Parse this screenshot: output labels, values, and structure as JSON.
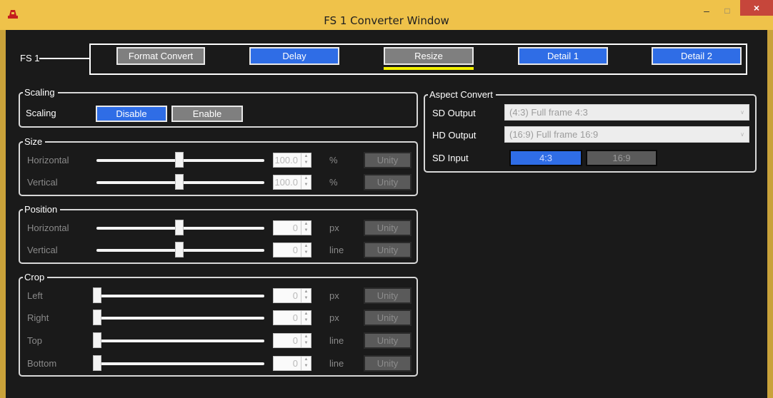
{
  "window": {
    "title": "FS 1 Converter Window",
    "minimize": "–",
    "maximize": "□",
    "close": "×"
  },
  "colors": {
    "accent_blue": "#2f6de6",
    "inactive_gray": "#7f7f7f",
    "title_bar": "#efc24a",
    "close_red": "#c6463b",
    "selected_underline": "#f3f000"
  },
  "fs": {
    "label": "FS 1",
    "tabs": [
      "Format Convert",
      "Delay",
      "Resize",
      "Detail 1",
      "Detail 2"
    ],
    "selected_tab": "Resize"
  },
  "scaling": {
    "title": "Scaling",
    "label": "Scaling",
    "disable": "Disable",
    "enable": "Enable",
    "selected": "Disable"
  },
  "size": {
    "title": "Size",
    "horizontal": {
      "label": "Horizontal",
      "value": "100.0",
      "unit": "%",
      "slider_level": 0.5
    },
    "vertical": {
      "label": "Vertical",
      "value": "100.0",
      "unit": "%",
      "slider_level": 0.5
    },
    "unity": "Unity"
  },
  "position": {
    "title": "Position",
    "horizontal": {
      "label": "Horizontal",
      "value": "0",
      "unit": "px",
      "slider_level": 0.5
    },
    "vertical": {
      "label": "Vertical",
      "value": "0",
      "unit": "line",
      "slider_level": 0.5
    },
    "unity": "Unity"
  },
  "crop": {
    "title": "Crop",
    "left": {
      "label": "Left",
      "value": "0",
      "unit": "px",
      "slider_level": 0
    },
    "right": {
      "label": "Right",
      "value": "0",
      "unit": "px",
      "slider_level": 0
    },
    "top": {
      "label": "Top",
      "value": "0",
      "unit": "line",
      "slider_level": 0
    },
    "bottom": {
      "label": "Bottom",
      "value": "0",
      "unit": "line",
      "slider_level": 0
    },
    "unity": "Unity"
  },
  "aspect": {
    "title": "Aspect Convert",
    "sd_output": {
      "label": "SD Output",
      "value": "(4:3) Full frame 4:3"
    },
    "hd_output": {
      "label": "HD Output",
      "value": "(16:9) Full frame 16:9"
    },
    "sd_input": {
      "label": "SD Input",
      "opt1": "4:3",
      "opt2": "16:9",
      "selected": "4:3"
    }
  }
}
